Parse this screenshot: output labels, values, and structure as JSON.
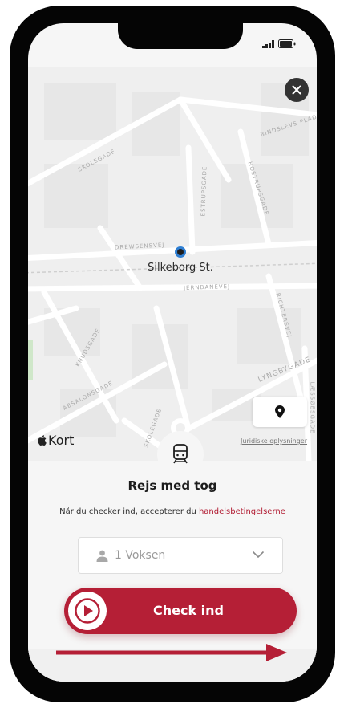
{
  "map": {
    "station_name": "Silkeborg St.",
    "streets": [
      "SKOLEGADE",
      "BINDSLEVS PLADS",
      "ESTRUPSGADE",
      "HOSTRUPSGADE",
      "DREWSENSVEJ",
      "JERNBANEVEJ",
      "RICHTERSVEJ",
      "KNUDSGADE",
      "ABSALONSGADE",
      "LYNGBYGADE",
      "SKOLEGADE",
      "LÆSSØESGADE"
    ],
    "provider_label": "Kort",
    "legal_link": "Juridiske oplysninger"
  },
  "sheet": {
    "title": "Rejs med tog",
    "terms_text": "Når du checker ind, accepterer du ",
    "terms_link": "handelsbetingelserne",
    "passenger_value": "1 Voksen",
    "checkin_label": "Check ind"
  },
  "icons": {
    "close": "close-icon",
    "location": "location-pin-icon",
    "train": "train-icon",
    "person": "person-icon",
    "chevron": "chevron-down-icon",
    "play": "play-icon",
    "apple": "apple-logo-icon"
  },
  "colors": {
    "brand_red": "#b51f36",
    "link_red": "#b0182f",
    "station_blue": "#2f7fd3"
  }
}
